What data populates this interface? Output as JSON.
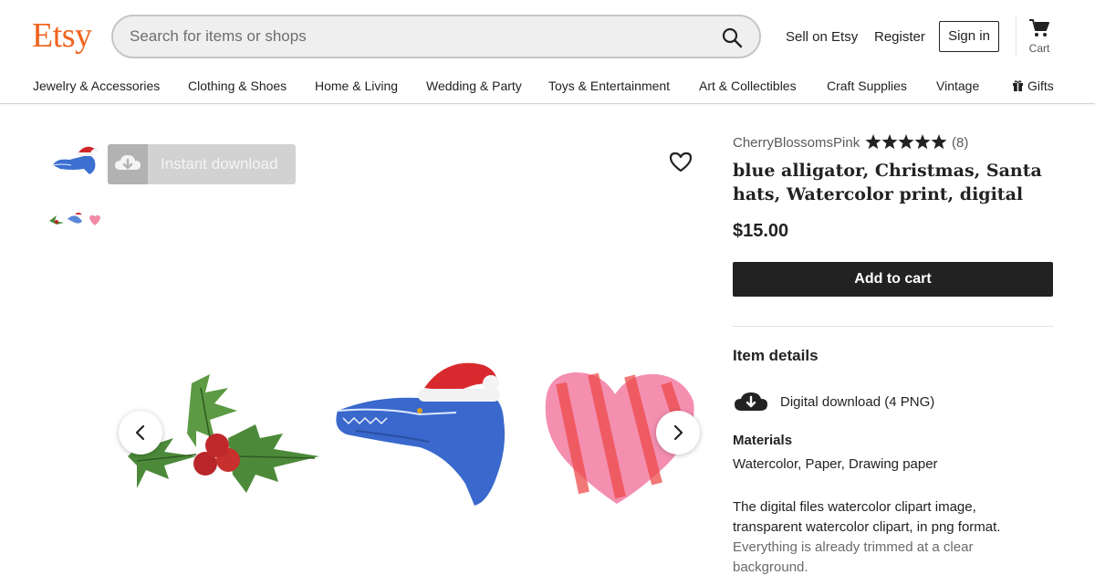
{
  "header": {
    "logo": "Etsy",
    "search_placeholder": "Search for items or shops",
    "sell_link": "Sell on Etsy",
    "register_link": "Register",
    "signin_button": "Sign in",
    "cart_label": "Cart",
    "brand_color": "#F1641E"
  },
  "categories": [
    "Jewelry & Accessories",
    "Clothing & Shoes",
    "Home & Living",
    "Wedding & Party",
    "Toys & Entertainment",
    "Art & Collectibles",
    "Craft Supplies",
    "Vintage",
    "Gifts"
  ],
  "gallery": {
    "instant_download_label": "Instant download",
    "images": [
      "blue alligator with santa hat",
      "holly, alligator and heart set"
    ]
  },
  "listing": {
    "shop_name": "CherryBlossomsPink",
    "rating": 5,
    "review_count": "(8)",
    "title": "blue alligator, Christmas, Santa hats, Watercolor print, digital",
    "price": "$15.00",
    "add_to_cart": "Add to cart",
    "details_heading": "Item details",
    "download_info": "Digital download (4 PNG)",
    "materials_heading": "Materials",
    "materials_value": "Watercolor, Paper, Drawing paper",
    "description_main": "The digital files watercolor clipart image, transparent watercolor clipart, in png format.",
    "description_faded": "Everything is already trimmed at a clear background."
  }
}
